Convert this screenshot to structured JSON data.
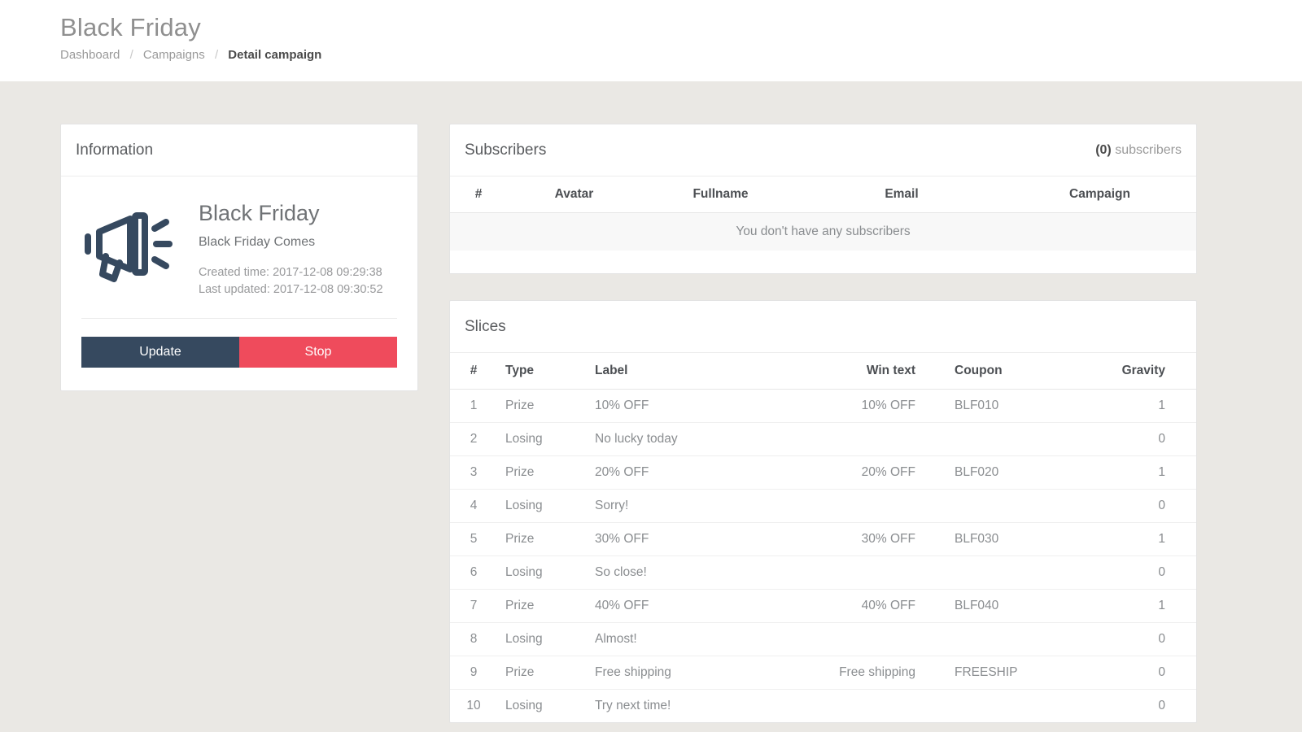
{
  "header": {
    "title": "Black Friday",
    "breadcrumb": [
      {
        "label": "Dashboard",
        "current": false
      },
      {
        "label": "Campaigns",
        "current": false
      },
      {
        "label": "Detail campaign",
        "current": true
      }
    ],
    "separator": "/"
  },
  "information": {
    "panel_title": "Information",
    "icon": "megaphone-icon",
    "campaign_name": "Black Friday",
    "campaign_description": "Black Friday Comes",
    "created_time": "Created time: 2017-12-08 09:29:38",
    "last_updated": "Last updated: 2017-12-08 09:30:52",
    "update_label": "Update",
    "stop_label": "Stop"
  },
  "subscribers": {
    "panel_title": "Subscribers",
    "count": "0",
    "count_prefix": "(",
    "count_suffix": ")",
    "count_label": " subscribers",
    "columns": [
      "#",
      "Avatar",
      "Fullname",
      "Email",
      "Campaign"
    ],
    "empty_message": "You don't have any subscribers",
    "rows": []
  },
  "slices": {
    "panel_title": "Slices",
    "columns": [
      "#",
      "Type",
      "Label",
      "Win text",
      "Coupon",
      "Gravity"
    ],
    "rows": [
      {
        "num": "1",
        "type": "Prize",
        "label": "10% OFF",
        "win_text": "10% OFF",
        "coupon": "BLF010",
        "gravity": "1"
      },
      {
        "num": "2",
        "type": "Losing",
        "label": "No lucky today",
        "win_text": "",
        "coupon": "",
        "gravity": "0"
      },
      {
        "num": "3",
        "type": "Prize",
        "label": "20% OFF",
        "win_text": "20% OFF",
        "coupon": "BLF020",
        "gravity": "1"
      },
      {
        "num": "4",
        "type": "Losing",
        "label": "Sorry!",
        "win_text": "",
        "coupon": "",
        "gravity": "0"
      },
      {
        "num": "5",
        "type": "Prize",
        "label": "30% OFF",
        "win_text": "30% OFF",
        "coupon": "BLF030",
        "gravity": "1"
      },
      {
        "num": "6",
        "type": "Losing",
        "label": "So close!",
        "win_text": "",
        "coupon": "",
        "gravity": "0"
      },
      {
        "num": "7",
        "type": "Prize",
        "label": "40% OFF",
        "win_text": "40% OFF",
        "coupon": "BLF040",
        "gravity": "1"
      },
      {
        "num": "8",
        "type": "Losing",
        "label": "Almost!",
        "win_text": "",
        "coupon": "",
        "gravity": "0"
      },
      {
        "num": "9",
        "type": "Prize",
        "label": "Free shipping",
        "win_text": "Free shipping",
        "coupon": "FREESHIP",
        "gravity": "0"
      },
      {
        "num": "10",
        "type": "Losing",
        "label": "Try next time!",
        "win_text": "",
        "coupon": "",
        "gravity": "0"
      }
    ]
  },
  "colors": {
    "page_background": "#eae8e4",
    "card_background": "#ffffff",
    "update_button": "#36495f",
    "stop_button": "#ef4b5c",
    "icon": "#36495f",
    "body_text": "#8a8d90",
    "heading_text": "#4c4f53"
  }
}
